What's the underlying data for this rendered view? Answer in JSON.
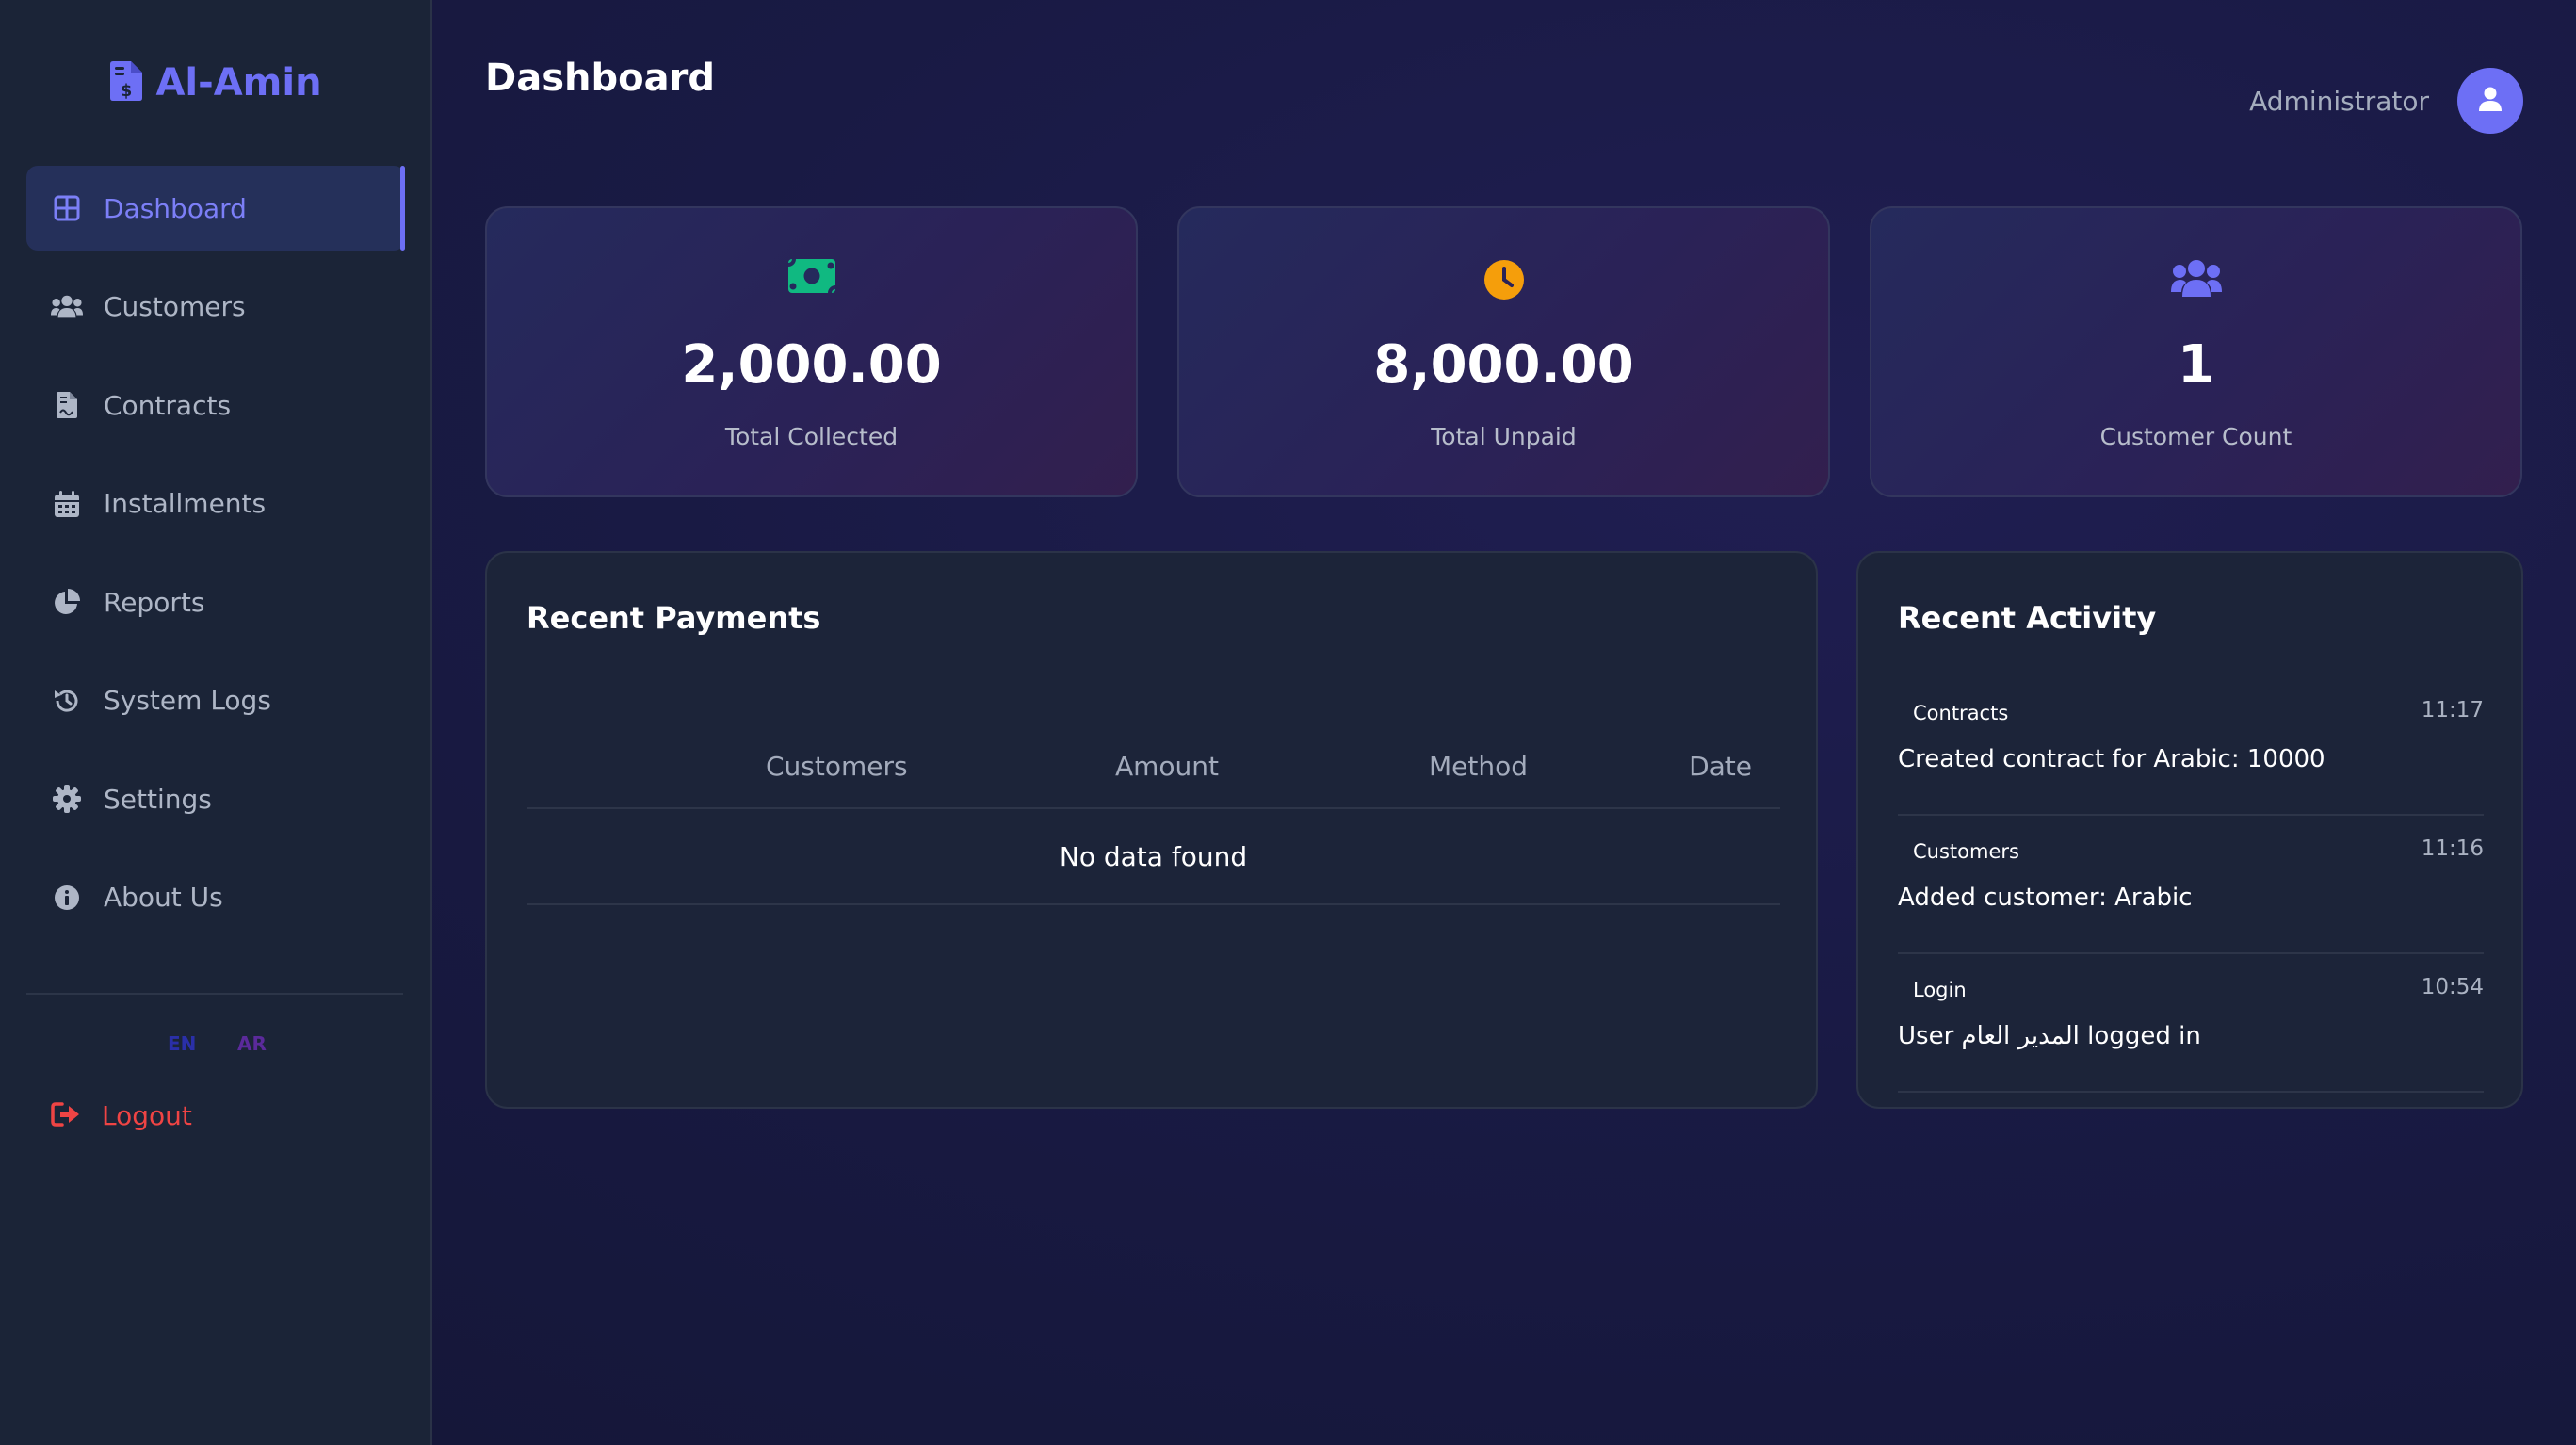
{
  "app": {
    "name": "Al-Amin",
    "accent": "#6d6ff5"
  },
  "sidebar": {
    "items": [
      {
        "label": "Dashboard",
        "icon": "grid-icon",
        "active": true
      },
      {
        "label": "Customers",
        "icon": "users-icon"
      },
      {
        "label": "Contracts",
        "icon": "file-contract-icon"
      },
      {
        "label": "Installments",
        "icon": "calendar-icon"
      },
      {
        "label": "Reports",
        "icon": "pie-chart-icon"
      },
      {
        "label": "System Logs",
        "icon": "history-icon"
      },
      {
        "label": "Settings",
        "icon": "gear-icon"
      },
      {
        "label": "About Us",
        "icon": "info-icon"
      }
    ],
    "languages": {
      "en": "EN",
      "ar": "AR"
    },
    "logout_label": "Logout"
  },
  "header": {
    "title": "Dashboard",
    "user_name": "Administrator"
  },
  "stats": [
    {
      "value": "2,000.00",
      "label": "Total Collected",
      "icon": "money-bill-icon",
      "icon_color": "#10b981"
    },
    {
      "value": "8,000.00",
      "label": "Total Unpaid",
      "icon": "clock-icon",
      "icon_color": "#f59e0b"
    },
    {
      "value": "1",
      "label": "Customer Count",
      "icon": "users-icon",
      "icon_color": "#6d6ff5"
    }
  ],
  "recent_payments": {
    "title": "Recent Payments",
    "columns": [
      "Customers",
      "Amount",
      "Method",
      "Date"
    ],
    "rows": [],
    "empty_text": "No data found"
  },
  "recent_activity": {
    "title": "Recent Activity",
    "items": [
      {
        "type": "Contracts",
        "time": "11:17",
        "text": "Created contract for Arabic: 10000"
      },
      {
        "type": "Customers",
        "time": "11:16",
        "text": "Added customer: Arabic"
      },
      {
        "type": "Login",
        "time": "10:54",
        "text": "User المدير العام logged in"
      }
    ]
  }
}
